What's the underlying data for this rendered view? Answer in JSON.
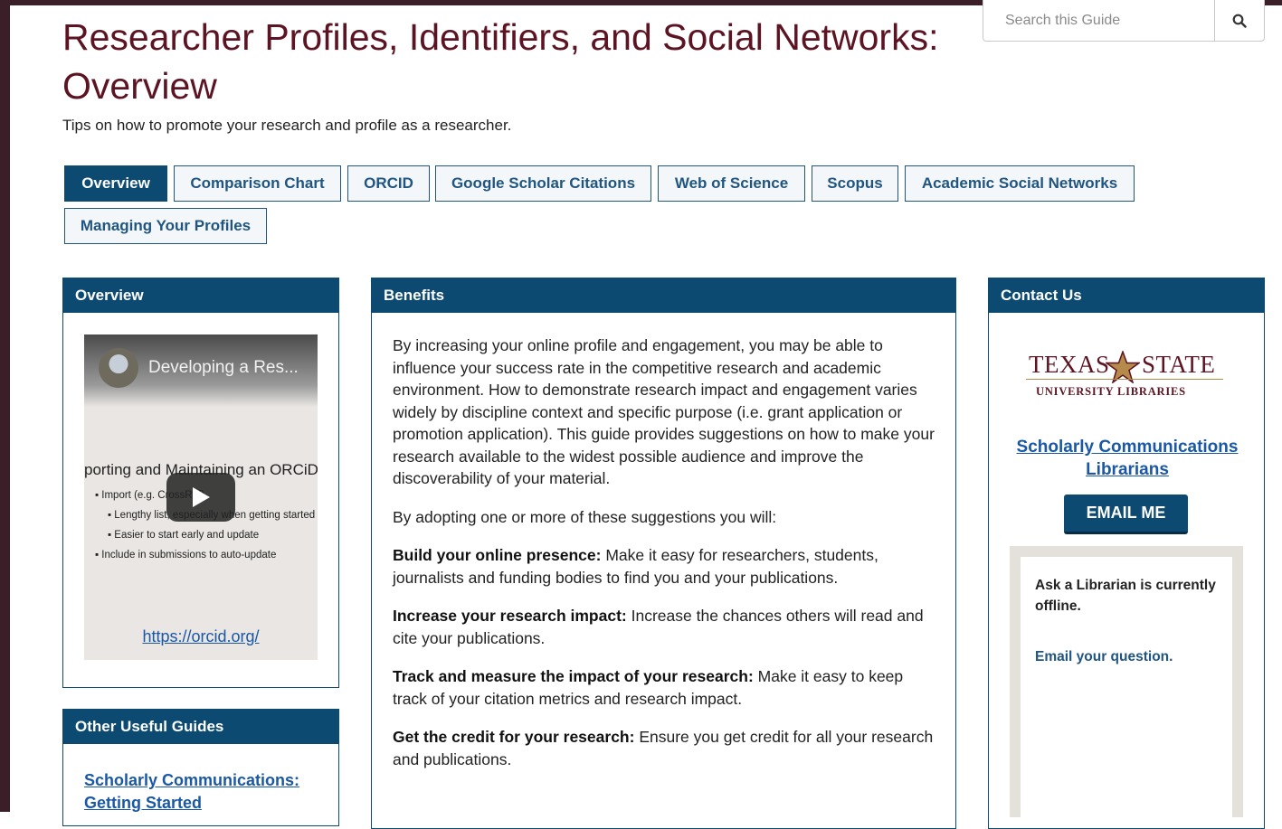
{
  "page": {
    "title": "Researcher Profiles, Identifiers, and Social Networks: Overview",
    "subtitle": "Tips on how to promote your research and profile as a researcher."
  },
  "search": {
    "placeholder": "Search this Guide",
    "icon": "search-icon"
  },
  "tabs": [
    {
      "label": "Overview",
      "active": true
    },
    {
      "label": "Comparison Chart"
    },
    {
      "label": "ORCID"
    },
    {
      "label": "Google Scholar Citations"
    },
    {
      "label": "Web of Science"
    },
    {
      "label": "Scopus"
    },
    {
      "label": "Academic Social Networks"
    },
    {
      "label": "Managing Your Profiles"
    }
  ],
  "overview_box": {
    "heading": "Overview",
    "video": {
      "title": "Developing a Res...",
      "slide_title": "porting and Maintaining an ORCiD",
      "bullets": [
        "Import (e.g. CrossRef)",
        "Lengthy list, especially when getting started",
        "Easier to start early and update",
        "Include in submissions to auto-update"
      ],
      "link": "https://orcid.org/",
      "play_icon": "play-icon"
    }
  },
  "other_guides": {
    "heading": "Other Useful Guides",
    "links": [
      "Scholarly Communications: Getting Started"
    ]
  },
  "benefits": {
    "heading": "Benefits",
    "intro": "By increasing your online profile and engagement, you may be able to influence your success rate in the competitive research and academic environment. How to demonstrate research impact and engagement varies widely by discipline context and specific purpose (i.e. grant application or promotion application). This guide provides suggestions on how to make your research available to the widest possible audience and improve the discoverability of your material.",
    "lead": "By adopting one or more of these suggestions you will:",
    "items": [
      {
        "title": "Build your online presence:",
        "text": " Make it easy for researchers, students, journalists and funding bodies to find you and your publications."
      },
      {
        "title": "Increase your research impact:",
        "text": " Increase the chances others will read and cite your publications."
      },
      {
        "title": "Track and measure the impact of your research:",
        "text": " Make it easy to keep track of your citation metrics and research impact."
      },
      {
        "title": "Get the credit for your research:",
        "text": " Ensure you get credit for all your research and publications."
      }
    ]
  },
  "contact": {
    "heading": "Contact Us",
    "logo_text_left": "TEXAS",
    "logo_text_right": "STATE",
    "logo_sub": "UNIVERSITY LIBRARIES",
    "librarians_link": "Scholarly Communications Librarians",
    "email_button": "EMAIL ME",
    "chat_status": "Ask a Librarian is currently offline.",
    "chat_link": "Email your question.",
    "brand_color": "#5c1423",
    "accent_color": "#0c4a72"
  }
}
